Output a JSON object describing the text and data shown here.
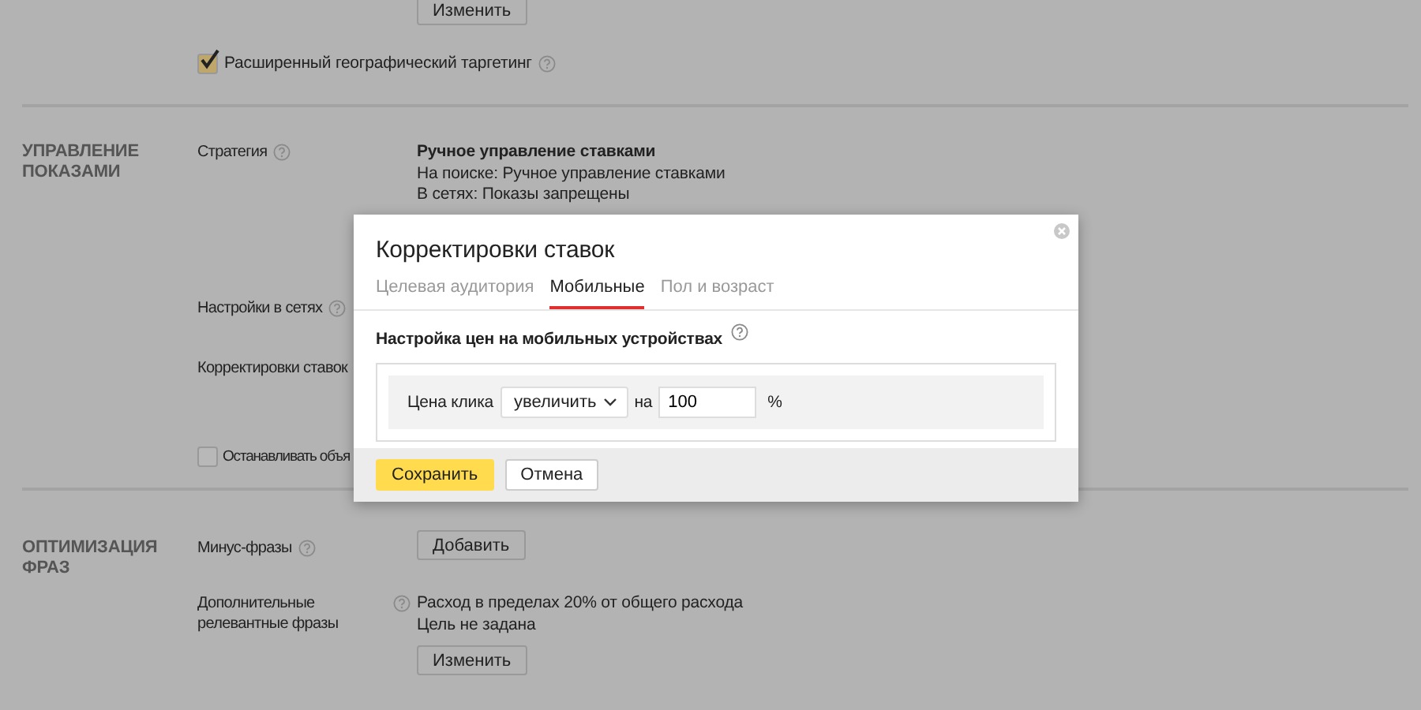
{
  "top_button": "Изменить",
  "geo_checkbox": {
    "label": "Расширенный географический таргетинг",
    "checked": true
  },
  "sections": [
    {
      "title": "УПРАВЛЕНИЕ ПОКАЗАМИ",
      "rows": [
        {
          "label": "Стратегия",
          "help": true,
          "values": [
            {
              "text": "Ручное управление ставками",
              "kind": "bold"
            },
            {
              "text": "На поиске: Ручное управление ставками",
              "kind": "plain"
            },
            {
              "text": "В сетях: Показы запрещены",
              "kind": "plain"
            }
          ]
        },
        {
          "label": "Настройки в сетях",
          "help": true
        },
        {
          "label": "Корректировки ставок"
        },
        {
          "label": "Останавливать объя",
          "kind": "checkbox",
          "checked": false
        }
      ]
    },
    {
      "title": "ОПТИМИЗАЦИЯ ФРАЗ",
      "rows": [
        {
          "label": "Минус-фразы",
          "help": true,
          "button": "Добавить"
        },
        {
          "label": "Дополнительные релевантные фразы",
          "help": true,
          "values": [
            {
              "text": "Расход в пределах 20% от общего расхода",
              "kind": "plain"
            },
            {
              "text": "Цель не задана",
              "kind": "plain"
            }
          ],
          "button": "Изменить"
        }
      ]
    }
  ],
  "dialog": {
    "title": "Корректировки ставок",
    "tabs": [
      {
        "label": "Целевая аудитория",
        "selected": false
      },
      {
        "label": "Мобильные",
        "selected": true
      },
      {
        "label": "Пол и возраст",
        "selected": false
      }
    ],
    "heading": "Настройка цен на мобильных устройствах",
    "price_label": "Цена клика",
    "action": "увеличить",
    "by_label": "на",
    "value": "100",
    "unit": "%",
    "buttons": [
      {
        "label": "Сохранить",
        "kind": "primary"
      },
      {
        "label": "Отмена",
        "kind": "default"
      }
    ]
  }
}
